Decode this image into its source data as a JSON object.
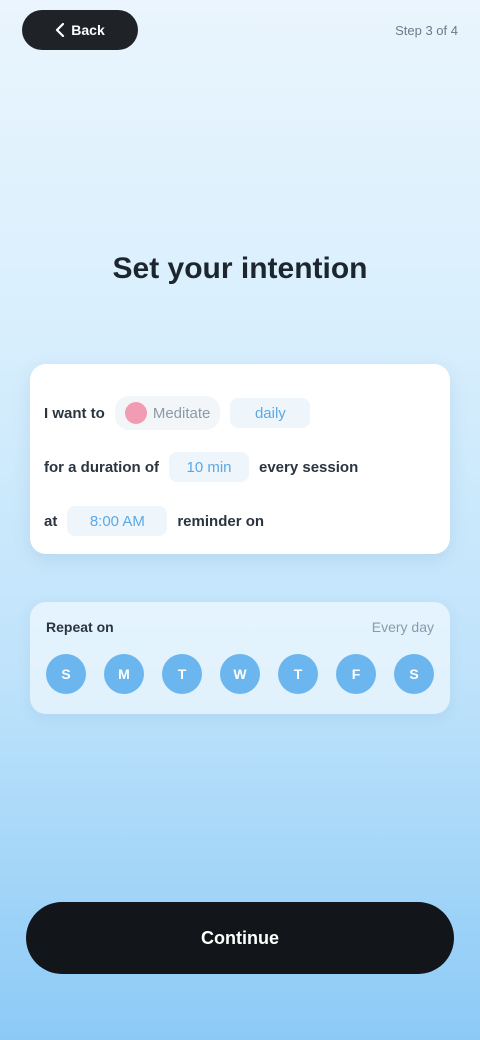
{
  "header": {
    "back_label": "Back",
    "back_icon": "chevron-left-icon",
    "step_text": "Step 3 of 4"
  },
  "title": "Set your intention",
  "main_card": {
    "row1": {
      "label": "I want to",
      "chip_text": "Meditate",
      "field_value": "daily"
    },
    "row2": {
      "label": "for a duration of",
      "field_value": "10 min",
      "suffix": "every session"
    },
    "row3": {
      "label": "at",
      "field_value": "8:00 AM",
      "suffix": "reminder on"
    }
  },
  "days_card": {
    "title": "Repeat on",
    "side_text": "Every day",
    "days": [
      "S",
      "M",
      "T",
      "W",
      "T",
      "F",
      "S"
    ]
  },
  "cta": {
    "label": "Continue"
  },
  "colors": {
    "accent": "#6bb6ee",
    "cta_background": "#12161b",
    "chip_dot": "#f29cb4"
  }
}
